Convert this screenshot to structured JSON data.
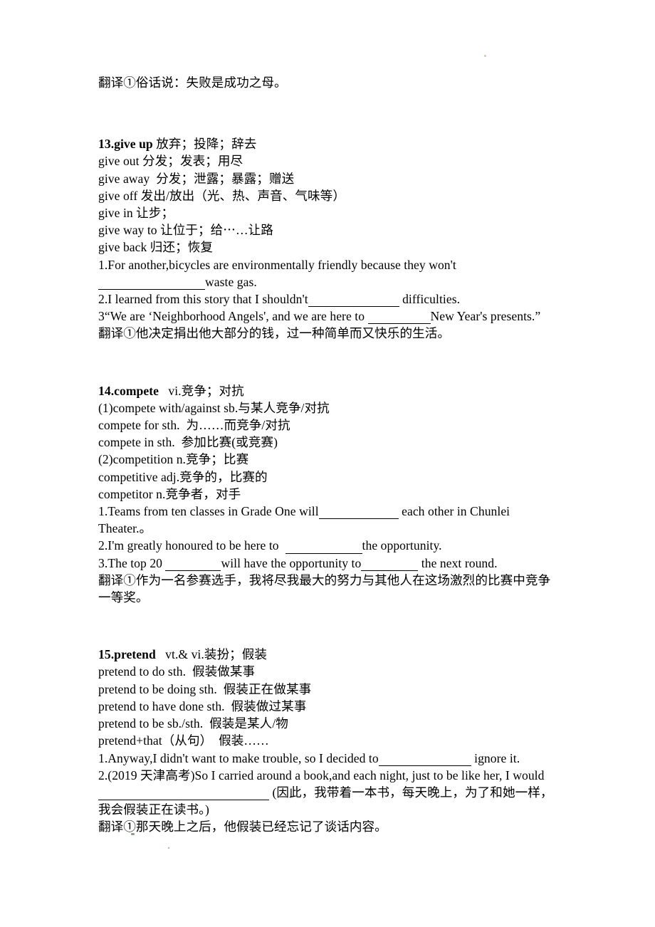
{
  "document": {
    "type": "english-vocabulary-worksheet",
    "language": "zh-CN + en",
    "page_background": "#ffffff",
    "text_color": "#000000"
  },
  "top_block": {
    "translation_line": "翻译①俗话说：失败是成功之母。"
  },
  "entries": [
    {
      "id": "entry-13",
      "headword_number": "13.give up",
      "headword_gloss": " 放弃；投降；辞去",
      "phrases": [
        "give out 分发；发表；用尽",
        "give away  分发；泄露；暴露；赠送",
        "give off 发出/放出（光、热、声音、气味等）",
        "give in 让步；",
        "give way to 让位于；给⋯…让路",
        "give back 归还；恢复"
      ],
      "exercises": [
        {
          "id": "ex-13-1",
          "segments": [
            {
              "kind": "text",
              "value": "1.For another,bicycles are environmentally friendly because they won't"
            },
            {
              "kind": "blank",
              "width": "b-w150"
            },
            {
              "kind": "text",
              "value": "waste gas."
            }
          ]
        },
        {
          "id": "ex-13-2",
          "segments": [
            {
              "kind": "text",
              "value": "2.I learned from this story that I shouldn't"
            },
            {
              "kind": "blank",
              "width": "b-w128"
            },
            {
              "kind": "text",
              "value": " difficulties."
            }
          ]
        },
        {
          "id": "ex-13-3",
          "segments": [
            {
              "kind": "text",
              "value": "3“We are ‘Neighborhood Angels', and we are here to "
            },
            {
              "kind": "blank",
              "width": "b-w88"
            },
            {
              "kind": "text",
              "value": "New Year's presents.”"
            }
          ]
        }
      ],
      "translation_line": "翻译①他决定捐出他大部分的钱，过一种简单而又快乐的生活。"
    },
    {
      "id": "entry-14",
      "headword_number": "14.compete",
      "headword_gloss": "   vi.竞争；对抗",
      "phrases": [
        "(1)compete with/against sb.与某人竞争/对抗",
        "compete for sth.  为……而竞争/对抗",
        "compete in sth.  参加比赛(或竞赛)",
        "(2)competition n.竞争；比赛",
        "competitive adj.竞争的，比赛的",
        "competitor n.竞争者，对手"
      ],
      "exercises": [
        {
          "id": "ex-14-1",
          "segments": [
            {
              "kind": "text",
              "value": "1.Teams from ten classes in Grade One will"
            },
            {
              "kind": "blank",
              "width": "b-w112"
            },
            {
              "kind": "text",
              "value": " each other in Chunlei Theater.。"
            }
          ]
        },
        {
          "id": "ex-14-2",
          "segments": [
            {
              "kind": "text",
              "value": "2.I'm greatly honoured to be here to  "
            },
            {
              "kind": "blank",
              "width": "b-w108"
            },
            {
              "kind": "text",
              "value": "the opportunity."
            }
          ]
        },
        {
          "id": "ex-14-3",
          "segments": [
            {
              "kind": "text",
              "value": "3.The top 20 "
            },
            {
              "kind": "blank",
              "width": "b-w78"
            },
            {
              "kind": "text",
              "value": "will have the opportunity to"
            },
            {
              "kind": "blank",
              "width": "b-w80"
            },
            {
              "kind": "text",
              "value": " the next round."
            }
          ]
        }
      ],
      "translation_line": "翻译①作为一名参赛选手，我将尽我最大的努力与其他人在这场激烈的比赛中竞争一等奖。"
    },
    {
      "id": "entry-15",
      "headword_number": "15.pretend",
      "headword_gloss": "   vt.& vi.装扮；假装",
      "phrases": [
        "pretend to do sth.  假装做某事",
        "pretend to be doing sth.  假装正在做某事",
        "pretend to have done sth.  假装做过某事",
        "pretend to be sb./sth.  假装是某人/物",
        "pretend+that（从句）  假装……"
      ],
      "exercises": [
        {
          "id": "ex-15-1",
          "segments": [
            {
              "kind": "text",
              "value": "1.Anyway,I didn't want to make trouble, so I decided to"
            },
            {
              "kind": "blank",
              "width": "b-w130"
            },
            {
              "kind": "text",
              "value": " ignore it."
            }
          ]
        },
        {
          "id": "ex-15-2",
          "segments": [
            {
              "kind": "text",
              "value": "2.(2019 天津高考)So I carried around a book,and each night, just to be like her, I would"
            },
            {
              "kind": "blank",
              "width": "b-w240"
            },
            {
              "kind": "text",
              "value": " (因此，我带着一本书，每天晚上，为了和她一样，我会假装正在读书。)"
            }
          ]
        }
      ],
      "translation_line": "翻译①那天晚上之后，他假装已经忘记了谈话内容。"
    }
  ]
}
